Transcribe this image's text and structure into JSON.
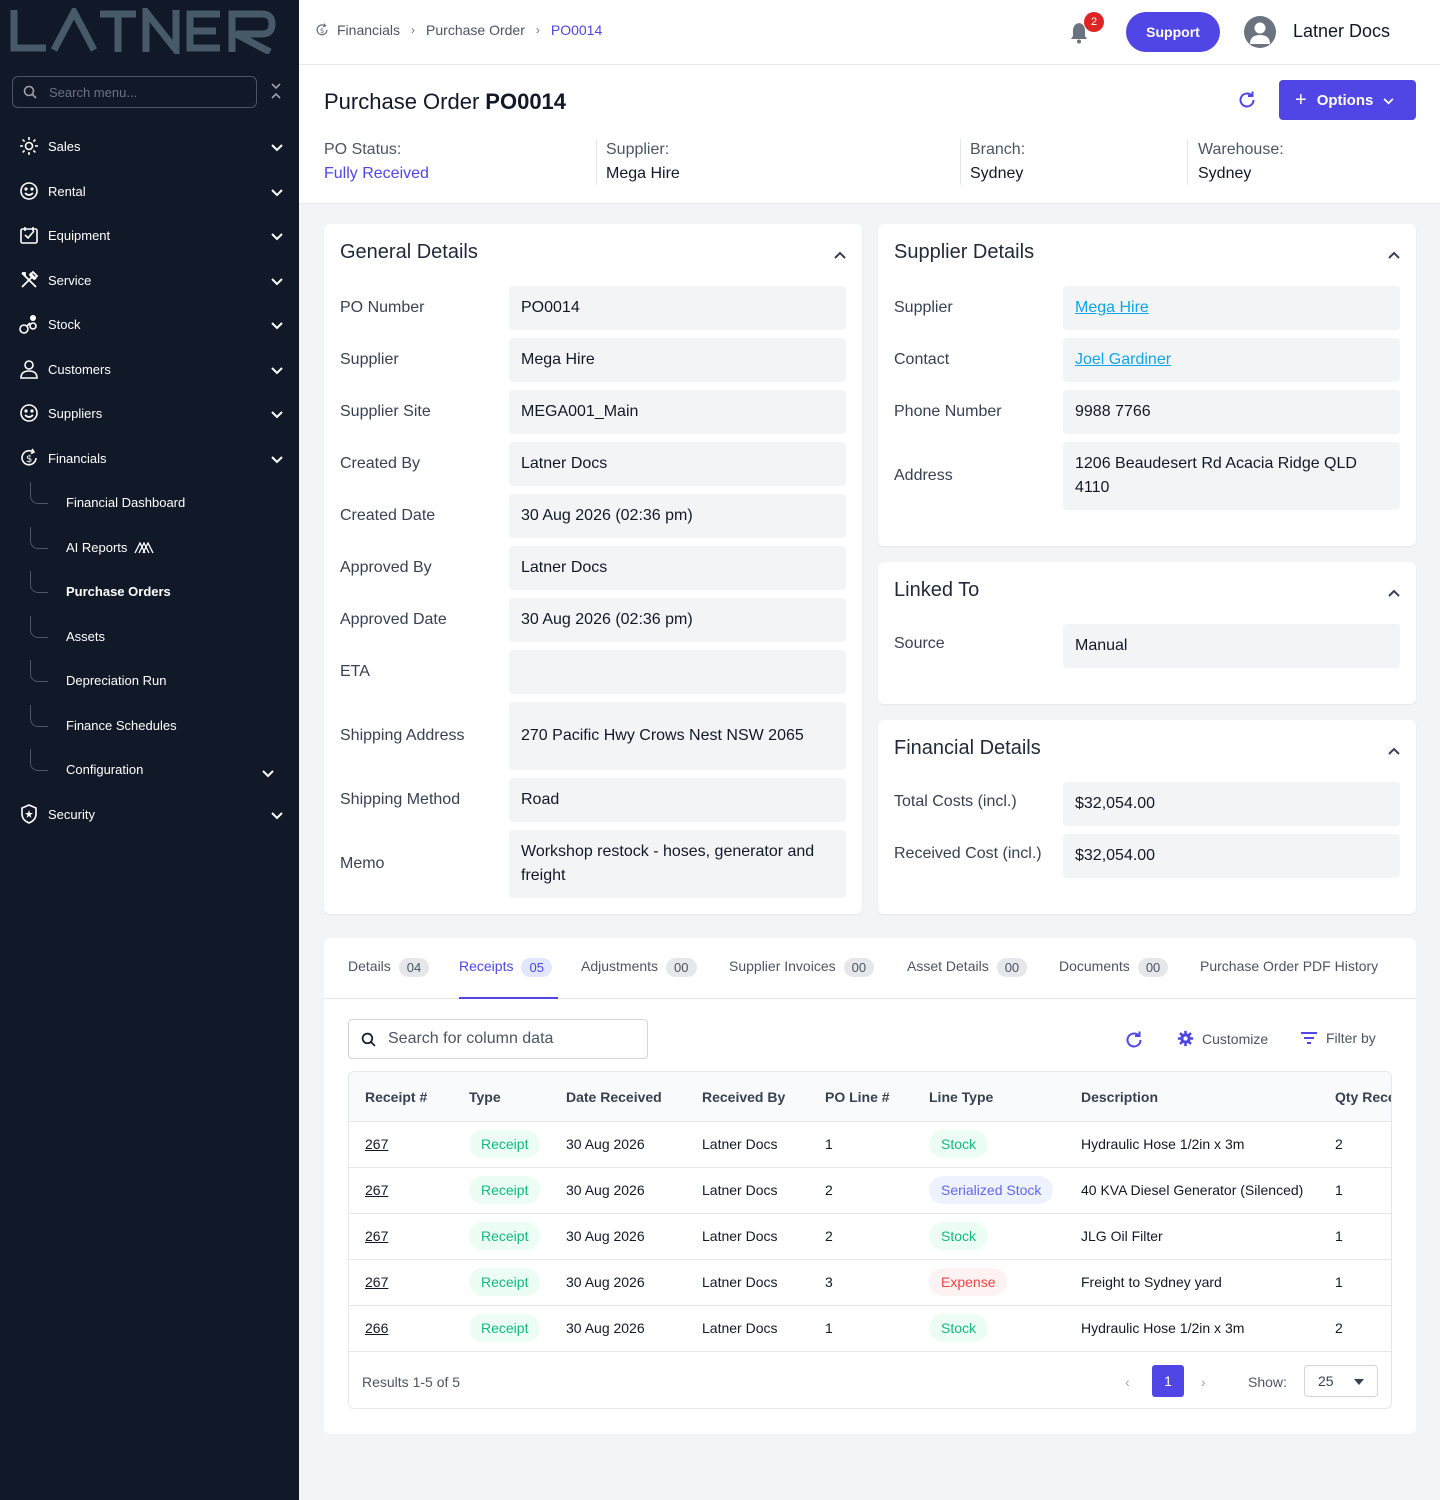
{
  "brand": {
    "logo": "LATNER"
  },
  "sidebar": {
    "search_placeholder": "Search menu...",
    "items": [
      {
        "label": "Sales",
        "icon": "sales-icon"
      },
      {
        "label": "Rental",
        "icon": "rental-icon"
      },
      {
        "label": "Equipment",
        "icon": "equipment-icon"
      },
      {
        "label": "Service",
        "icon": "service-icon"
      },
      {
        "label": "Stock",
        "icon": "stock-icon"
      },
      {
        "label": "Customers",
        "icon": "customers-icon"
      },
      {
        "label": "Suppliers",
        "icon": "suppliers-icon"
      },
      {
        "label": "Financials",
        "icon": "financials-icon"
      },
      {
        "label": "Security",
        "icon": "security-icon"
      }
    ],
    "financials_sub": [
      {
        "label": "Financial Dashboard"
      },
      {
        "label": "AI Reports"
      },
      {
        "label": "Purchase Orders"
      },
      {
        "label": "Assets"
      },
      {
        "label": "Depreciation Run"
      },
      {
        "label": "Finance Schedules"
      },
      {
        "label": "Configuration"
      }
    ]
  },
  "topbar": {
    "breadcrumb": [
      "Financials",
      "Purchase Order",
      "PO0014"
    ],
    "notification_count": "2",
    "support_label": "Support",
    "user_name": "Latner Docs"
  },
  "header": {
    "title_prefix": "Purchase Order",
    "title_id": "PO0014",
    "options_label": "Options",
    "po_status_label": "PO Status:",
    "po_status_value": "Fully Received",
    "supplier_label": "Supplier:",
    "supplier_value": "Mega Hire",
    "branch_label": "Branch:",
    "branch_value": "Sydney",
    "warehouse_label": "Warehouse:",
    "warehouse_value": "Sydney"
  },
  "general": {
    "title": "General Details",
    "fields": [
      {
        "label": "PO Number",
        "value": "PO0014"
      },
      {
        "label": "Supplier",
        "value": "Mega Hire"
      },
      {
        "label": "Supplier Site",
        "value": "MEGA001_Main"
      },
      {
        "label": "Created By",
        "value": "Latner Docs"
      },
      {
        "label": "Created Date",
        "value": "30 Aug 2026 (02:36 pm)"
      },
      {
        "label": "Approved By",
        "value": "Latner Docs"
      },
      {
        "label": "Approved Date",
        "value": "30 Aug 2026 (02:36 pm)"
      },
      {
        "label": "ETA",
        "value": ""
      },
      {
        "label": "Shipping Address",
        "value": "270 Pacific Hwy Crows Nest NSW 2065"
      },
      {
        "label": "Shipping Method",
        "value": "Road"
      },
      {
        "label": "Memo",
        "value": "Workshop restock - hoses, generator and freight"
      }
    ]
  },
  "supplier_details": {
    "title": "Supplier Details",
    "fields": [
      {
        "label": "Supplier",
        "value": "Mega Hire"
      },
      {
        "label": "Contact",
        "value": "Joel Gardiner"
      },
      {
        "label": "Phone Number",
        "value": "9988 7766"
      },
      {
        "label": "Address",
        "value": "1206 Beaudesert Rd Acacia Ridge QLD 4110"
      }
    ]
  },
  "linked_to": {
    "title": "Linked To",
    "fields": [
      {
        "label": "Source",
        "value": "Manual"
      }
    ]
  },
  "financial_details": {
    "title": "Financial Details",
    "fields": [
      {
        "label": "Total Costs (incl.)",
        "value": "$32,054.00"
      },
      {
        "label": "Received Cost (incl.)",
        "value": "$32,054.00"
      }
    ]
  },
  "tabs": [
    {
      "label": "Details",
      "count": "04"
    },
    {
      "label": "Receipts",
      "count": "05"
    },
    {
      "label": "Adjustments",
      "count": "00"
    },
    {
      "label": "Supplier Invoices",
      "count": "00"
    },
    {
      "label": "Asset Details",
      "count": "00"
    },
    {
      "label": "Documents",
      "count": "00"
    },
    {
      "label": "Purchase Order PDF History"
    }
  ],
  "table_tools": {
    "search_placeholder": "Search for column data",
    "customize_label": "Customize",
    "filter_label": "Filter by"
  },
  "table": {
    "columns": [
      "Receipt #",
      "Type",
      "Date Received",
      "Received By",
      "PO Line #",
      "Line Type",
      "Description",
      "Qty Rece"
    ],
    "rows": [
      {
        "receipt": "267",
        "type": "Receipt",
        "date": "30 Aug 2026",
        "by": "Latner Docs",
        "line": "1",
        "line_type": "Stock",
        "line_type_color": "green",
        "description": "Hydraulic Hose 1/2in x 3m",
        "qty": "2"
      },
      {
        "receipt": "267",
        "type": "Receipt",
        "date": "30 Aug 2026",
        "by": "Latner Docs",
        "line": "2",
        "line_type": "Serialized Stock",
        "line_type_color": "purple",
        "description": "40 KVA Diesel Generator (Silenced)",
        "qty": "1"
      },
      {
        "receipt": "267",
        "type": "Receipt",
        "date": "30 Aug 2026",
        "by": "Latner Docs",
        "line": "2",
        "line_type": "Stock",
        "line_type_color": "green",
        "description": "JLG Oil Filter",
        "qty": "1"
      },
      {
        "receipt": "267",
        "type": "Receipt",
        "date": "30 Aug 2026",
        "by": "Latner Docs",
        "line": "3",
        "line_type": "Expense",
        "line_type_color": "red",
        "description": "Freight to Sydney yard",
        "qty": "1"
      },
      {
        "receipt": "266",
        "type": "Receipt",
        "date": "30 Aug 2026",
        "by": "Latner Docs",
        "line": "1",
        "line_type": "Stock",
        "line_type_color": "green",
        "description": "Hydraulic Hose 1/2in x 3m",
        "qty": "2"
      }
    ],
    "results_text": "Results 1-5 of 5",
    "current_page": "1",
    "show_label": "Show:",
    "page_size": "25"
  },
  "colors": {
    "accent": "#4f46e5",
    "sidebar_bg": "#111827",
    "link": "#0ea5e9"
  }
}
